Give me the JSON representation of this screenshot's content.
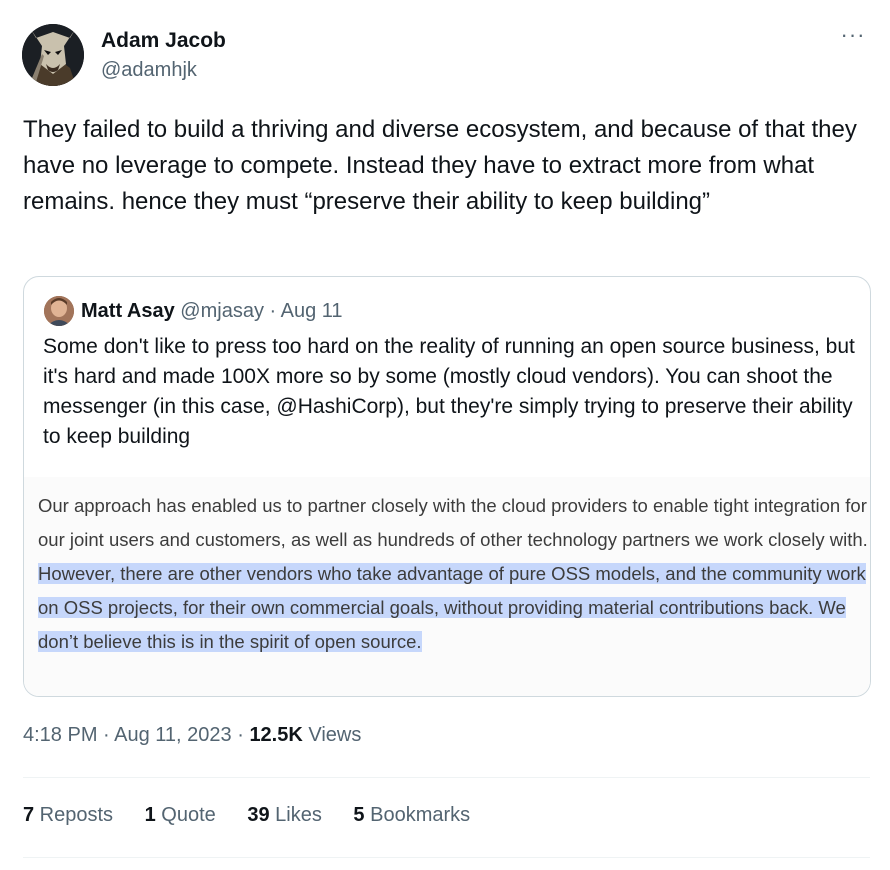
{
  "author": {
    "name": "Adam Jacob",
    "handle": "@adamhjk"
  },
  "menu": {
    "more_label": "···"
  },
  "tweet": {
    "text": "They failed to build a thriving and diverse ecosystem, and because of that they have no leverage to compete. Instead they have to extract more from what remains. hence they must “preserve their ability to keep building”"
  },
  "quoted": {
    "name": "Matt Asay",
    "handle": "@mjasay",
    "separator": "·",
    "date": "Aug 11",
    "text": "Some don't like to press too hard on the reality of running an open source business, but it's hard and made 100X more so by some (mostly cloud vendors). You can shoot the messenger (in this case, @HashiCorp), but they're simply trying to preserve their ability to keep building",
    "image": {
      "text_plain": "Our approach has enabled us to partner closely with the cloud providers to enable tight integration for our joint users and customers, as well as hundreds of other technology partners we work closely with. ",
      "text_highlighted": "However, there are other vendors who take advantage of pure OSS models, and the community work on OSS projects, for their own commercial goals, without providing material contributions back. We don’t believe this is in the spirit of open source.",
      "highlight_color": "#c6d7fb"
    }
  },
  "meta": {
    "time": "4:18 PM · Aug 11, 2023 · ",
    "views_count": "12.5K",
    "views_label": " Views"
  },
  "stats": [
    {
      "num": "7",
      "label": " Reposts"
    },
    {
      "num": "1",
      "label": " Quote"
    },
    {
      "num": "39",
      "label": " Likes"
    },
    {
      "num": "5",
      "label": " Bookmarks"
    }
  ],
  "colors": {
    "text": "#0f1419",
    "muted": "#536471",
    "border": "#cfd9de"
  }
}
